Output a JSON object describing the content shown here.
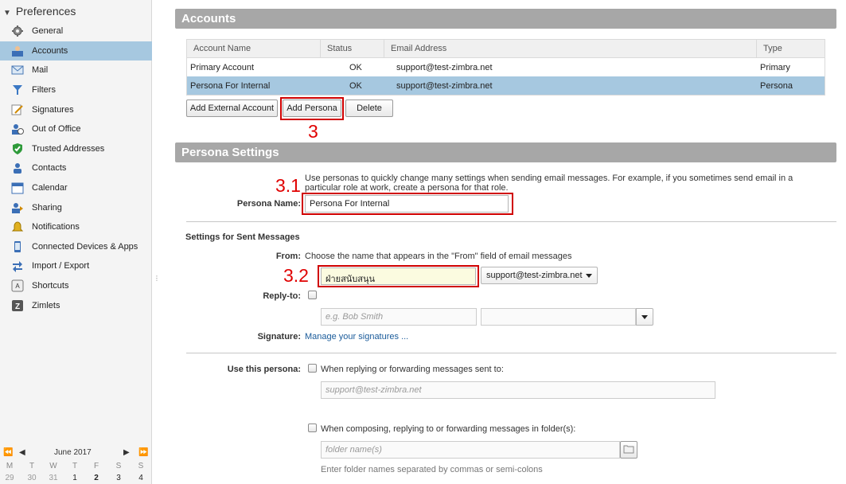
{
  "sidebar": {
    "title": "Preferences",
    "items": [
      {
        "label": "General",
        "icon": "gear-icon"
      },
      {
        "label": "Accounts",
        "icon": "accounts-icon"
      },
      {
        "label": "Mail",
        "icon": "mail-icon"
      },
      {
        "label": "Filters",
        "icon": "filter-icon"
      },
      {
        "label": "Signatures",
        "icon": "signature-icon"
      },
      {
        "label": "Out of Office",
        "icon": "out-of-office-icon"
      },
      {
        "label": "Trusted Addresses",
        "icon": "shield-check-icon"
      },
      {
        "label": "Contacts",
        "icon": "contact-icon"
      },
      {
        "label": "Calendar",
        "icon": "calendar-icon"
      },
      {
        "label": "Sharing",
        "icon": "sharing-icon"
      },
      {
        "label": "Notifications",
        "icon": "bell-icon"
      },
      {
        "label": "Connected Devices & Apps",
        "icon": "device-icon"
      },
      {
        "label": "Import / Export",
        "icon": "import-export-icon"
      },
      {
        "label": "Shortcuts",
        "icon": "keyboard-icon"
      },
      {
        "label": "Zimlets",
        "icon": "zimlet-icon"
      }
    ],
    "selected_index": 1
  },
  "calendar": {
    "month": "June 2017",
    "weekdays": [
      "M",
      "T",
      "W",
      "T",
      "F",
      "S",
      "S"
    ],
    "days": [
      "29",
      "30",
      "31",
      "1",
      "2",
      "3",
      "4"
    ]
  },
  "accounts": {
    "title": "Accounts",
    "columns": [
      "Account Name",
      "Status",
      "Email Address",
      "Type"
    ],
    "rows": [
      {
        "name": "Primary Account",
        "status": "OK",
        "email": "support@test-zimbra.net",
        "type": "Primary"
      },
      {
        "name": "Persona For Internal",
        "status": "OK",
        "email": "support@test-zimbra.net",
        "type": "Persona"
      }
    ],
    "buttons": {
      "add_external": "Add External Account",
      "add_persona": "Add Persona",
      "delete": "Delete"
    }
  },
  "persona": {
    "title": "Persona Settings",
    "intro": "Use personas to quickly change many settings when sending email messages. For example, if you sometimes send email in a particular role at work, create a persona for that role.",
    "name_label": "Persona Name:",
    "name_value": "Persona For Internal",
    "sent_heading": "Settings for Sent Messages",
    "from_label": "From:",
    "from_desc": "Choose the name that appears in the \"From\" field of email messages",
    "from_name_value": "ฝ่ายสนับสนุน",
    "from_address": "support@test-zimbra.net",
    "reply_label": "Reply-to:",
    "reply_name_placeholder": "e.g. Bob Smith",
    "signature_label": "Signature:",
    "signature_link": "Manage your signatures ...",
    "use_label": "Use this persona:",
    "opt_reply_text": "When replying or forwarding messages sent to:",
    "opt_reply_placeholder": "support@test-zimbra.net",
    "opt_folder_text": "When composing, replying to or forwarding messages in folder(s):",
    "folder_placeholder": "folder name(s)",
    "folder_hint": "Enter folder names separated by commas or semi-colons"
  },
  "annotations": {
    "a1": "3",
    "a2": "3.1",
    "a3": "3.2"
  },
  "colors": {
    "selected": "#a6c8e0",
    "header_bar": "#a7a7a7",
    "annotation": "#e00000",
    "link": "#1a5b9a"
  }
}
